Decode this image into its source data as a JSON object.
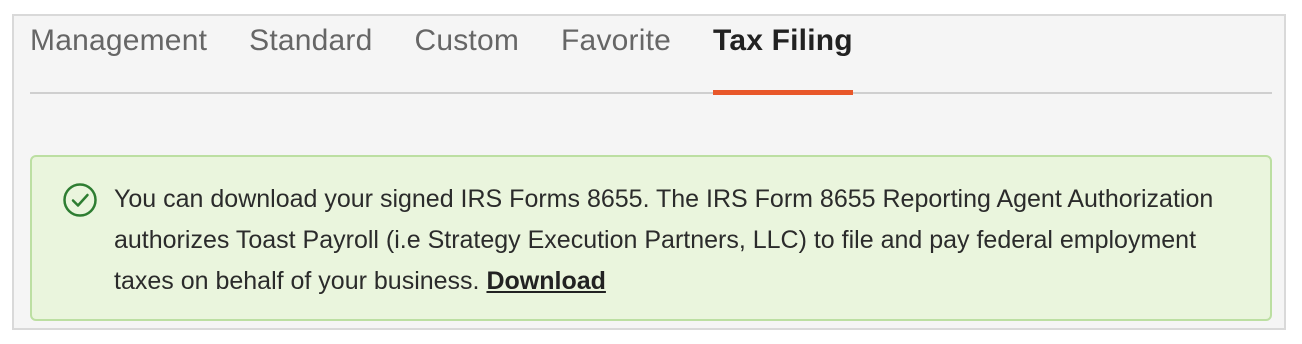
{
  "tabs": [
    {
      "label": "Management",
      "active": false
    },
    {
      "label": "Standard",
      "active": false
    },
    {
      "label": "Custom",
      "active": false
    },
    {
      "label": "Favorite",
      "active": false
    },
    {
      "label": "Tax Filing",
      "active": true
    }
  ],
  "alert": {
    "icon": "check-circle-icon",
    "message": "You can download your signed IRS Forms 8655. The IRS Form 8655 Reporting Agent Authorization authorizes Toast Payroll (i.e Strategy Execution Partners, LLC) to file and pay federal employment taxes on behalf of your business.",
    "link_label": "Download"
  },
  "colors": {
    "accent": "#e8572a",
    "alert_background": "#eaf5dd",
    "alert_border": "#bcdfa2",
    "success_icon": "#2e7d32"
  }
}
